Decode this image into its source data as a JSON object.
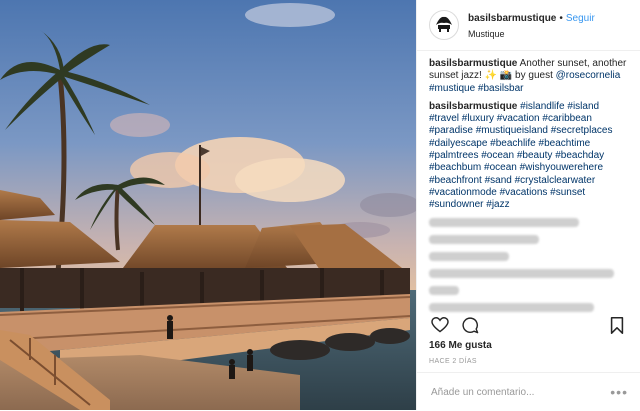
{
  "post": {
    "username": "basilsbarmustique",
    "separator": "•",
    "follow_label": "Seguir",
    "location": "Mustique",
    "caption": {
      "username": "basilsbarmustique",
      "text": "Another sunset, another sunset jazz! ✨ 📸 by guest",
      "mention": "@rosecornelia",
      "tags": [
        "#mustique",
        "#basilsbar"
      ]
    },
    "hashtag_comment": {
      "username": "basilsbarmustique",
      "text": "#islandlife #island #travel #luxury #vacation #caribbean #paradise #mustiqueisland #secretplaces #dailyescape #beachlife #beachtime #palmtrees #ocean #beauty #beachday #beachbum #ocean #wishyouwerehere #beachfront #sand #crystalclearwater #vacationmode #vacations #sunset #sundowner #jazz"
    },
    "likes": "166 Me gusta",
    "time_ago": "HACE 2 DÍAS",
    "add_comment_placeholder": "Añade un comentario...",
    "more_label": "•••",
    "icons": {
      "like": "heart-icon",
      "comment": "comment-icon",
      "save": "bookmark-icon",
      "avatar": "basils-bar-logo"
    }
  }
}
